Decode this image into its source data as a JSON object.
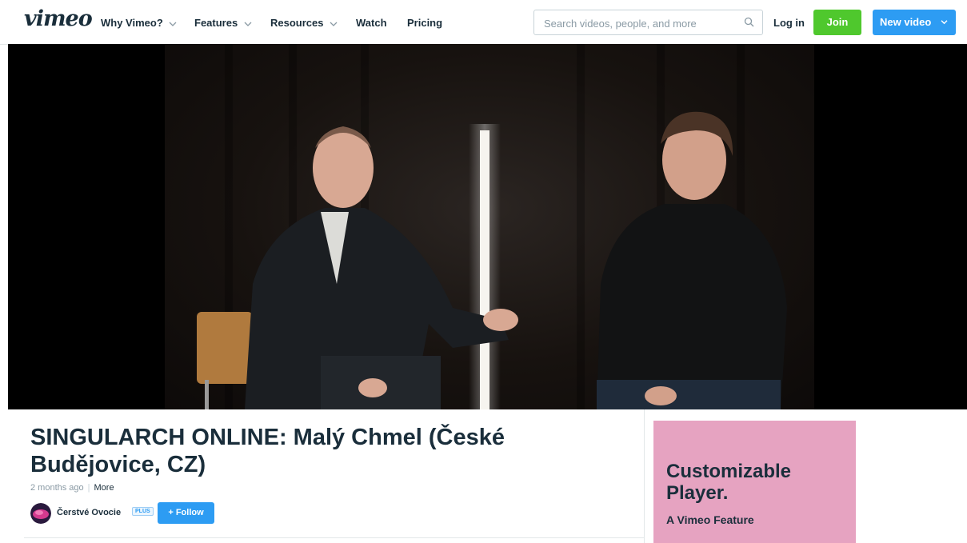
{
  "header": {
    "logo": "vimeo",
    "nav": [
      {
        "label": "Why Vimeo?",
        "has_dropdown": true
      },
      {
        "label": "Features",
        "has_dropdown": true
      },
      {
        "label": "Resources",
        "has_dropdown": true
      },
      {
        "label": "Watch",
        "has_dropdown": false
      },
      {
        "label": "Pricing",
        "has_dropdown": false
      }
    ],
    "search_placeholder": "Search videos, people, and more",
    "search_value": "",
    "login_label": "Log in",
    "join_label": "Join",
    "new_video_label": "New video"
  },
  "video": {
    "title": "SINGULARCH ONLINE: Malý Chmel (České Budějovice, CZ)",
    "posted": "2 months ago",
    "more_label": "More",
    "channel_name": "Čerstvé Ovocie",
    "channel_badge": "PLUS",
    "follow_label": "+ Follow"
  },
  "ad": {
    "headline": "Customizable Player.",
    "subline": "A Vimeo Feature",
    "background": "#e6a3c1"
  },
  "colors": {
    "join": "#4fc82d",
    "primary": "#2d9cf3",
    "text": "#1a2e3b"
  }
}
